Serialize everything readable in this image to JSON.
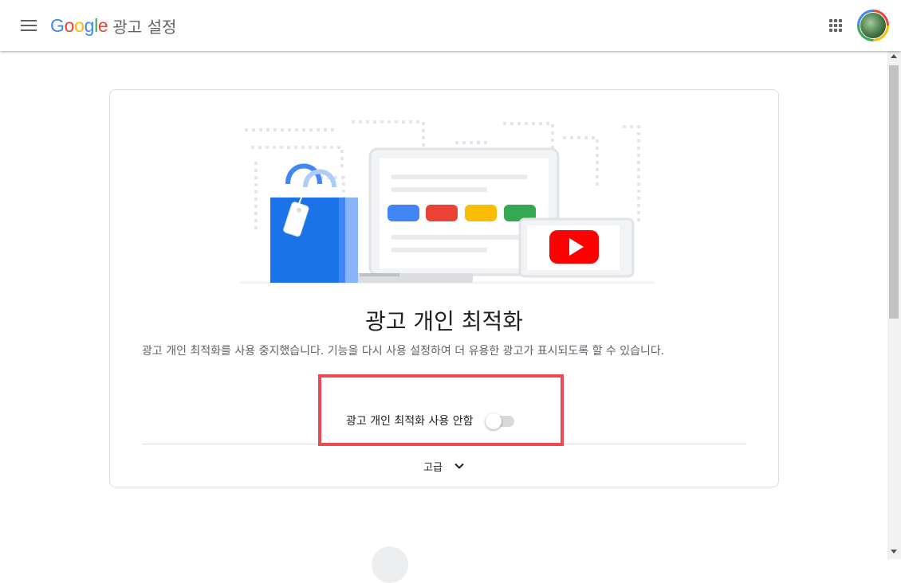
{
  "header": {
    "brand": "Google",
    "product": "광고 설정"
  },
  "main": {
    "title": "광고 개인 최적화",
    "description": "광고 개인 최적화를 사용 중지했습니다. 기능을 다시 사용 설정하여 더 유용한 광고가 표시되도록 할 수 있습니다.",
    "toggle_label": "광고 개인 최적화 사용 안함",
    "toggle_on": false,
    "advanced_label": "고급"
  },
  "colors": {
    "blue": "#4285f4",
    "red": "#ea4335",
    "yellow": "#fbbc04",
    "green": "#34a853",
    "youtube": "#ff0000",
    "highlight": "#ea4b53"
  },
  "icons": {
    "menu": "hamburger-icon",
    "apps": "grid-icon",
    "expand": "chevron-down-icon"
  }
}
